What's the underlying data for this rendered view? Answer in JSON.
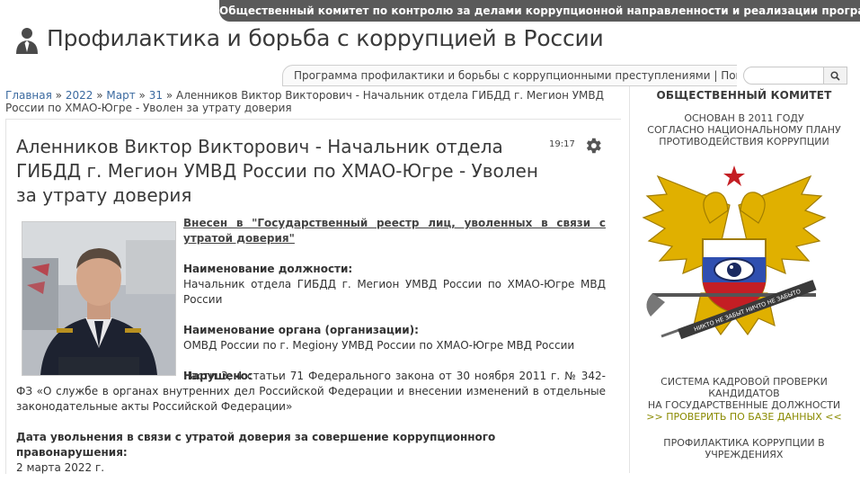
{
  "top_banner": "Общественный комитет по контролю за делами коррупционной направленности и реализации программы Президента РФ",
  "site_title": "Профилактика и борьба с коррупцией в России",
  "program_bar": {
    "text": "Программа профилактики и борьбы с коррупционными преступлениями | Поиск в БД:",
    "search_value": ""
  },
  "breadcrumb": {
    "items": [
      "Главная",
      "2022",
      "Март",
      "31"
    ],
    "separator": "»",
    "current": "Аленников Виктор Викторович - Начальник отдела ГИБДД г. Мегион УМВД России по ХМАО-Югре - Уволен за утрату доверия"
  },
  "article": {
    "title": "Аленников Виктор Викторович - Начальник отдела ГИБДД г. Мегион УМВД России по ХМАО-Югре - Уволен за утрату доверия",
    "time": "19:17",
    "registry_link": "Внесен в \"Государственный реестр лиц, уволенных в связи с утратой доверия\"",
    "position_label": "Наименование должности:",
    "position_value": "Начальник отдела ГИБДД г. Мегион УМВД России по ХМАО-Югре МВД России",
    "organ_label": "Наименование органа (организации):",
    "organ_value": "ОМВД России по г. Megiону УМВД России по ХМАО-Югре МВД России",
    "violation_label": "Нарушено:",
    "violation_value": "Части 3, 4 статьи 71 Федерального закона от 30 ноября 2011 г. № 342-ФЗ «О службе в органах внутренних дел Российской Федерации и внесении изменений в отдельные законодательные акты Российской Федерации»",
    "dismissal_label": "Дата увольнения в связи с утратой доверия за совершение коррупционного правонарушения:",
    "dismissal_value": "2 марта 2022 г.",
    "photo_caption": "ветее for corruption.ru"
  },
  "sidebar": {
    "heading": "ОБЩЕСТВЕННЫЙ КОМИТЕТ",
    "founded_line1": "ОСНОВАН В 2011 ГОДУ",
    "founded_line2": "СОГЛАСНО НАЦИОНАЛЬНОМУ ПЛАНУ",
    "founded_line3": "ПРОТИВОДЕЙСТВИЯ КОРРУПЦИИ",
    "emblem_ribbon": "НИКТО НЕ ЗАБЫТ НИЧТО НЕ ЗАБЫТО",
    "hr_line1": "СИСТЕМА КАДРОВОЙ ПРОВЕРКИ",
    "hr_line2": "КАНДИДАТОВ",
    "hr_line3": "НА ГОСУДАРСТВЕННЫЕ ДОЛЖНОСТИ",
    "hr_check_link": ">> ПРОВЕРИТЬ ПО БАЗЕ ДАННЫХ <<",
    "prevention_line1": "ПРОФИЛАКТИКА КОРРУПЦИИ В",
    "prevention_line2": "УЧРЕЖДЕНИЯХ"
  },
  "colors": {
    "banner_bg": "#5a5a5a",
    "link": "#3b6aa0",
    "check_link": "#8a8a00",
    "emblem_gold": "#e0b000"
  },
  "icons": [
    "person-tie-icon",
    "search-icon",
    "gear-icon"
  ]
}
